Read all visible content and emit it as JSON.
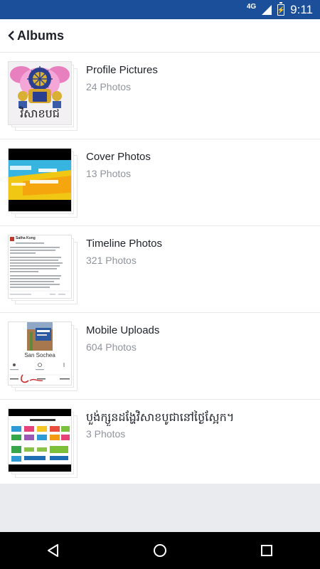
{
  "status_bar": {
    "network": "4G",
    "time": "9:11"
  },
  "app_bar": {
    "title": "Albums"
  },
  "albums": [
    {
      "name": "Profile Pictures",
      "count": "24 Photos",
      "thumb_caption": "វិសាខបជ"
    },
    {
      "name": "Cover Photos",
      "count": "13 Photos"
    },
    {
      "name": "Timeline Photos",
      "count": "321 Photos",
      "thumb_author": "Satha Kong"
    },
    {
      "name": "Mobile Uploads",
      "count": "604 Photos",
      "thumb_profile_name": "San Sochea"
    },
    {
      "name": "បួង់ក្សួនដង្ហែវិសាខបូជានៅថ្ងៃស្អែក។",
      "count": "3 Photos"
    }
  ],
  "colors": {
    "status_bar": "#1b4f9a",
    "secondary_text": "#90949c",
    "primary_text": "#1d2129"
  },
  "icons": {
    "back": "chevron-left-icon",
    "nav_back": "triangle-back-icon",
    "nav_home": "circle-home-icon",
    "nav_recents": "square-recents-icon"
  }
}
